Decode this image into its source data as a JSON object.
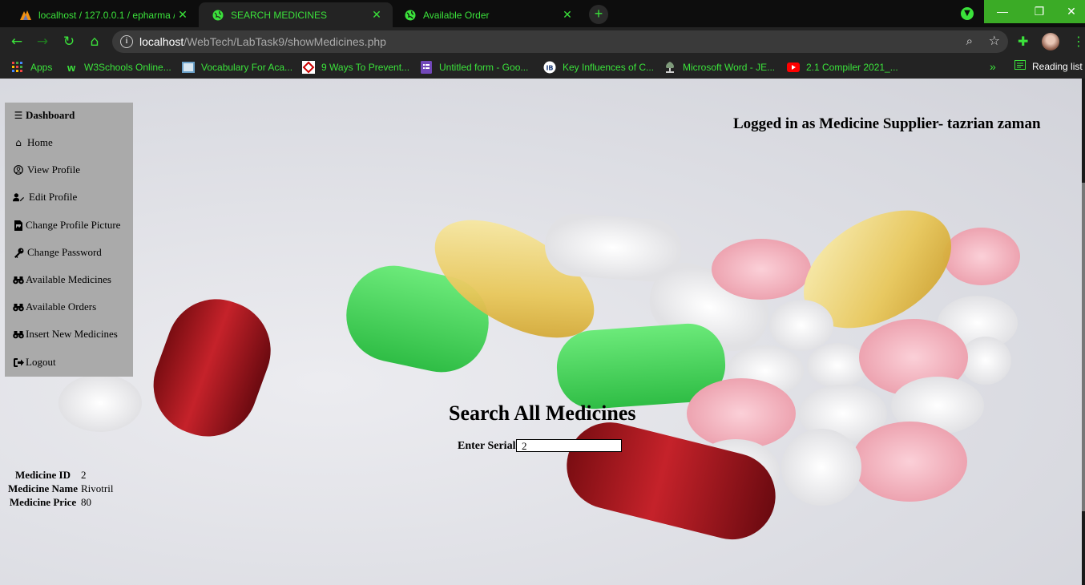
{
  "browser": {
    "tabs": [
      {
        "label": "localhost / 127.0.0.1 / epharma /",
        "icon": "phpmyadmin-icon",
        "active": false
      },
      {
        "label": "SEARCH MEDICINES",
        "icon": "globe-icon",
        "active": true
      },
      {
        "label": "Available Order",
        "icon": "globe-icon",
        "active": false
      }
    ],
    "new_tab": "+",
    "url_host": "localhost",
    "url_path": "/WebTech/LabTask9/showMedicines.php",
    "bookmarks": [
      {
        "label": "Apps",
        "icon": "apps-grid-icon"
      },
      {
        "label": "W3Schools Online...",
        "icon": "w3schools-icon"
      },
      {
        "label": "Vocabulary For Aca...",
        "icon": "book-icon"
      },
      {
        "label": "9 Ways To Prevent...",
        "icon": "diamond-icon"
      },
      {
        "label": "Untitled form - Goo...",
        "icon": "forms-icon"
      },
      {
        "label": "Key Influences of C...",
        "icon": "journal-icon"
      },
      {
        "label": "Microsoft Word - JE...",
        "icon": "tree-icon"
      },
      {
        "label": "2.1 Compiler 2021_...",
        "icon": "youtube-icon"
      }
    ],
    "bookmarks_more": "»",
    "reading_list": "Reading list"
  },
  "sidebar": {
    "title": "Dashboard",
    "items": [
      {
        "label": "Home",
        "icon": "home-icon"
      },
      {
        "label": "View Profile",
        "icon": "user-circle-icon"
      },
      {
        "label": "Edit Profile",
        "icon": "user-edit-icon"
      },
      {
        "label": "Change Profile Picture",
        "icon": "file-image-icon"
      },
      {
        "label": "Change Password",
        "icon": "key-icon"
      },
      {
        "label": "Available Medicines",
        "icon": "binoculars-icon"
      },
      {
        "label": "Available Orders",
        "icon": "binoculars-icon"
      },
      {
        "label": "Insert New Medicines",
        "icon": "binoculars-icon"
      },
      {
        "label": "Logout",
        "icon": "sign-out-icon"
      }
    ]
  },
  "header": {
    "logged_in": "Logged in as Medicine Supplier- tazrian zaman"
  },
  "search": {
    "title": "Search All Medicines",
    "serial_label": "Enter Serial:",
    "serial_value": "2"
  },
  "result": {
    "id_label": "Medicine ID",
    "id_value": "2",
    "name_label": "Medicine Name",
    "name_value": "Rivotril",
    "price_label": "Medicine Price",
    "price_value": "80"
  }
}
